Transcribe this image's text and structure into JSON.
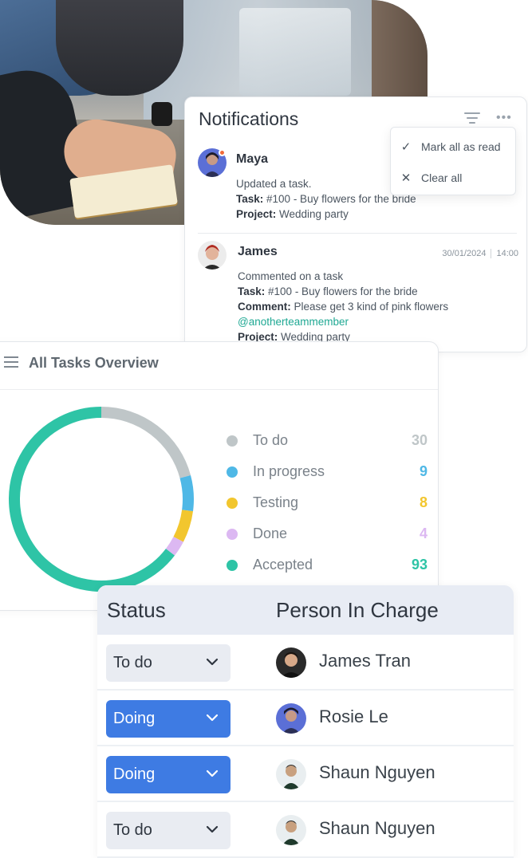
{
  "notifications": {
    "title": "Notifications",
    "menu": {
      "mark_all_read": "Mark all as read",
      "clear_all": "Clear all"
    },
    "items": [
      {
        "name": "Maya",
        "time": "",
        "date": "",
        "action": "Updated a task.",
        "task_label": "Task:",
        "task": "#100 - Buy flowers for the bride",
        "project_label": "Project:",
        "project": "Wedding party",
        "unread": true
      },
      {
        "name": "James",
        "date": "30/01/2024",
        "time": "14:00",
        "action": "Commented on a task",
        "task_label": "Task:",
        "task": "#100 - Buy flowers for the bride",
        "comment_label": "Comment:",
        "comment": "Please get 3 kind of pink flowers",
        "mention": "@anotherteammember",
        "project_label": "Project:",
        "project": "Wedding party"
      }
    ]
  },
  "tasks_overview": {
    "title": "All Tasks Overview",
    "legend": [
      {
        "label": "To do",
        "value": "30",
        "color": "#bfc6c8"
      },
      {
        "label": "In progress",
        "value": "9",
        "color": "#4fb8e6"
      },
      {
        "label": "Testing",
        "value": "8",
        "color": "#f2c62e"
      },
      {
        "label": "Done",
        "value": "4",
        "color": "#dcb8f2"
      },
      {
        "label": "Accepted",
        "value": "93",
        "color": "#2ec4a6"
      }
    ]
  },
  "chart_data": {
    "type": "pie",
    "donut": true,
    "categories": [
      "To do",
      "In progress",
      "Testing",
      "Done",
      "Accepted"
    ],
    "values": [
      30,
      9,
      8,
      4,
      93
    ],
    "colors": [
      "#bfc6c8",
      "#4fb8e6",
      "#f2c62e",
      "#dcb8f2",
      "#2ec4a6"
    ],
    "title": "All Tasks Overview",
    "legend": "right"
  },
  "status_table": {
    "headers": {
      "status": "Status",
      "person": "Person In Charge"
    },
    "rows": [
      {
        "status": "To do",
        "status_kind": "todo",
        "person": "James Tran"
      },
      {
        "status": "Doing",
        "status_kind": "doing",
        "person": "Rosie Le"
      },
      {
        "status": "Doing",
        "status_kind": "doing",
        "person": "Shaun Nguyen"
      },
      {
        "status": "To do",
        "status_kind": "todo",
        "person": "Shaun Nguyen"
      }
    ]
  },
  "icons": {
    "filter": "filter-icon",
    "more": "more-horizontal-icon",
    "check": "check-icon",
    "close": "close-icon",
    "list": "list-icon",
    "chevron": "chevron-down-icon"
  }
}
